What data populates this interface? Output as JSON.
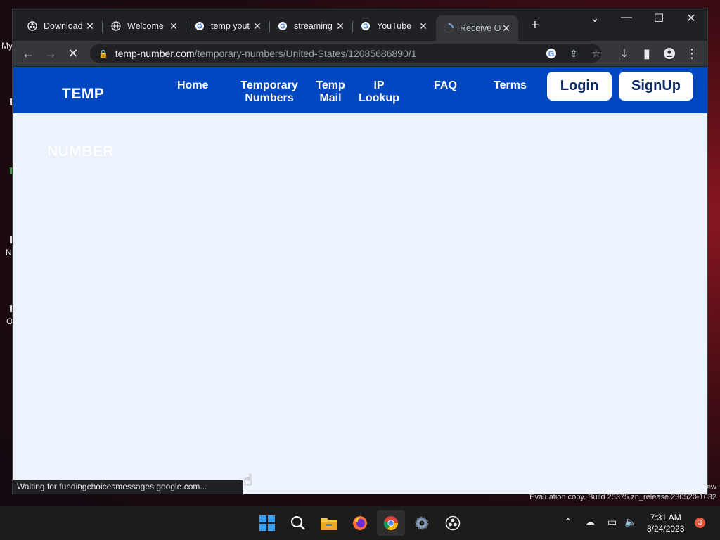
{
  "desktop": {
    "labels": [
      "My",
      "N",
      "O"
    ]
  },
  "browser": {
    "tabs": [
      {
        "title": "Download",
        "icon": "obs-icon",
        "active": false
      },
      {
        "title": "Welcome",
        "icon": "globe-icon",
        "active": false
      },
      {
        "title": "temp yout",
        "icon": "google-icon",
        "active": false
      },
      {
        "title": "streaming",
        "icon": "google-icon",
        "active": false
      },
      {
        "title": "YouTube",
        "icon": "google-icon",
        "active": false
      },
      {
        "title": "Receive O",
        "icon": "loading-icon",
        "active": true
      }
    ],
    "new_tab_label": "+",
    "url_host": "temp-number.com",
    "url_path": "/temporary-numbers/United-States/12085686890/1",
    "status_text": "Waiting for fundingchoicesmessages.google.com..."
  },
  "site": {
    "logo_top": "TEMP",
    "logo_bottom": "NUMBER",
    "nav": [
      {
        "label": "Home"
      },
      {
        "label": "Temporary Numbers"
      },
      {
        "label": "Temp Mail"
      },
      {
        "label": "IP Lookup"
      },
      {
        "label": "FAQ"
      },
      {
        "label": "Terms"
      }
    ],
    "login_label": "Login",
    "signup_label": "SignUp",
    "header_color": "#0047c2",
    "body_color": "#edf3fc"
  },
  "system": {
    "watermark_top": "ew",
    "watermark": "Evaluation copy. Build 25375.zn_release.230520-1632",
    "time": "7:31 AM",
    "date": "8/24/2023",
    "notification_count": "3"
  }
}
